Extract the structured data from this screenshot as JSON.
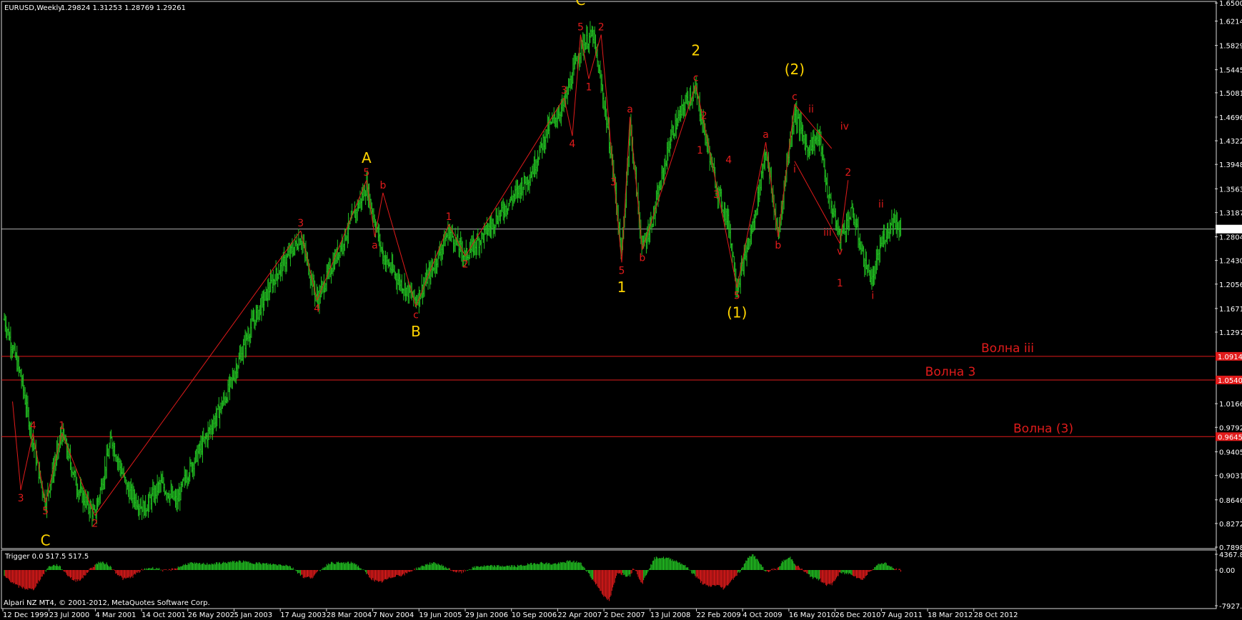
{
  "header": {
    "symbol": "EURUSD,Weekly",
    "ohlc": "1.29824 1.31253 1.28769 1.29261"
  },
  "indicator": {
    "label": "Trigger 0.0 517.5 517.5",
    "ticks": [
      "4367.8",
      "0.00",
      "-7927.2"
    ]
  },
  "footer": {
    "copyright": "Alpari NZ MT4, © 2001-2012, MetaQuotes Software Corp."
  },
  "colors": {
    "background": "#000000",
    "up_bar": "#22c222",
    "wave_line": "#e11b1b",
    "major_label": "#ffd400",
    "minor_label": "#e11b1b",
    "level_line": "#e11b1b",
    "price_line": "#c8c8c8"
  },
  "chart_data": {
    "type": "ohlc",
    "symbol": "EURUSD",
    "timeframe": "Weekly",
    "ylim": [
      0.7898,
      1.6502
    ],
    "price_ticks": [
      "1.62140",
      "1.58290",
      "1.54450",
      "1.50810",
      "1.46960",
      "1.43220",
      "1.39480",
      "1.35630",
      "1.31870",
      "1.28040",
      "1.24300",
      "1.20560",
      "1.16710",
      "1.12970",
      "1.09142",
      "1.05405",
      "1.01660",
      "0.97920",
      "0.94050",
      "0.90310",
      "0.86460",
      "0.82720",
      "0.78980",
      "1.65000"
    ],
    "x_labels": [
      "12 Dec 1999",
      "23 Jul 2000",
      "4 Mar 2001",
      "14 Oct 2001",
      "26 May 2002",
      "5 Jan 2003",
      "17 Aug 2003",
      "28 Mar 2004",
      "7 Nov 2004",
      "19 Jun 2005",
      "29 Jan 2006",
      "10 Sep 2006",
      "22 Apr 2007",
      "2 Dec 2007",
      "13 Jul 2008",
      "22 Feb 2009",
      "4 Oct 2009",
      "16 May 2010",
      "26 Dec 2010",
      "7 Aug 2011",
      "18 Mar 2012",
      "28 Oct 2012"
    ],
    "current_price": "1.29261",
    "price_path": [
      [
        0,
        1.15
      ],
      [
        0.4,
        1.06
      ],
      [
        0.8,
        0.92
      ],
      [
        1.0,
        0.86
      ],
      [
        1.4,
        0.97
      ],
      [
        1.8,
        0.88
      ],
      [
        2.2,
        0.84
      ],
      [
        2.6,
        0.96
      ],
      [
        3.0,
        0.88
      ],
      [
        3.4,
        0.85
      ],
      [
        3.8,
        0.89
      ],
      [
        4.2,
        0.86
      ],
      [
        4.4,
        0.9
      ],
      [
        4.8,
        0.95
      ],
      [
        5.4,
        1.03
      ],
      [
        6.0,
        1.14
      ],
      [
        6.6,
        1.22
      ],
      [
        7.2,
        1.28
      ],
      [
        7.6,
        1.18
      ],
      [
        8.0,
        1.24
      ],
      [
        8.4,
        1.3
      ],
      [
        8.8,
        1.36
      ],
      [
        9.2,
        1.25
      ],
      [
        9.6,
        1.21
      ],
      [
        10.0,
        1.18
      ],
      [
        10.4,
        1.23
      ],
      [
        10.8,
        1.29
      ],
      [
        11.2,
        1.25
      ],
      [
        11.6,
        1.28
      ],
      [
        12.2,
        1.33
      ],
      [
        12.8,
        1.38
      ],
      [
        13.2,
        1.45
      ],
      [
        13.6,
        1.49
      ],
      [
        14.0,
        1.58
      ],
      [
        14.3,
        1.6
      ],
      [
        14.6,
        1.48
      ],
      [
        14.8,
        1.38
      ],
      [
        15.0,
        1.25
      ],
      [
        15.2,
        1.46
      ],
      [
        15.5,
        1.26
      ],
      [
        15.8,
        1.32
      ],
      [
        16.2,
        1.44
      ],
      [
        16.6,
        1.5
      ],
      [
        16.8,
        1.51
      ],
      [
        17.0,
        1.45
      ],
      [
        17.3,
        1.36
      ],
      [
        17.6,
        1.3
      ],
      [
        17.8,
        1.2
      ],
      [
        18.2,
        1.3
      ],
      [
        18.5,
        1.42
      ],
      [
        18.8,
        1.28
      ],
      [
        19.0,
        1.39
      ],
      [
        19.2,
        1.48
      ],
      [
        19.5,
        1.42
      ],
      [
        19.8,
        1.44
      ],
      [
        20.0,
        1.35
      ],
      [
        20.3,
        1.28
      ],
      [
        20.6,
        1.32
      ],
      [
        20.9,
        1.24
      ],
      [
        21.1,
        1.21
      ],
      [
        21.3,
        1.27
      ],
      [
        21.6,
        1.31
      ],
      [
        21.8,
        1.29
      ]
    ],
    "levels": [
      {
        "label": "Волна iii",
        "price": 1.09142,
        "tag": "1.09142"
      },
      {
        "label": "Волна 3",
        "price": 1.05405,
        "tag": "1.05405"
      },
      {
        "label": "Волна (3)",
        "price": 0.9645,
        "tag": "0.96450"
      }
    ],
    "wave_labels_minor": [
      {
        "t": "3",
        "x": 0.4,
        "p": 0.88,
        "pos": "below"
      },
      {
        "t": "4",
        "x": 0.7,
        "p": 0.97,
        "pos": "above"
      },
      {
        "t": "5",
        "x": 1.0,
        "p": 0.86,
        "pos": "below"
      },
      {
        "t": "1",
        "x": 1.4,
        "p": 0.97,
        "pos": "above"
      },
      {
        "t": "2",
        "x": 2.2,
        "p": 0.84,
        "pos": "below"
      },
      {
        "t": "3",
        "x": 7.2,
        "p": 1.29,
        "pos": "above"
      },
      {
        "t": "4",
        "x": 7.6,
        "p": 1.18,
        "pos": "below"
      },
      {
        "t": "5",
        "x": 8.8,
        "p": 1.37,
        "pos": "above"
      },
      {
        "t": "a",
        "x": 9.0,
        "p": 1.28,
        "pos": "below"
      },
      {
        "t": "b",
        "x": 9.2,
        "p": 1.35,
        "pos": "above"
      },
      {
        "t": "c",
        "x": 10.0,
        "p": 1.17,
        "pos": "below"
      },
      {
        "t": "1",
        "x": 10.8,
        "p": 1.3,
        "pos": "above"
      },
      {
        "t": "2",
        "x": 11.2,
        "p": 1.25,
        "pos": "below"
      },
      {
        "t": "3",
        "x": 13.6,
        "p": 1.5,
        "pos": "above"
      },
      {
        "t": "4",
        "x": 13.8,
        "p": 1.44,
        "pos": "below"
      },
      {
        "t": "5",
        "x": 14.0,
        "p": 1.6,
        "pos": "above"
      },
      {
        "t": "1",
        "x": 14.2,
        "p": 1.53,
        "pos": "below"
      },
      {
        "t": "2",
        "x": 14.5,
        "p": 1.6,
        "pos": "above"
      },
      {
        "t": "3",
        "x": 14.8,
        "p": 1.38,
        "pos": "below"
      },
      {
        "t": "5",
        "x": 15.0,
        "p": 1.24,
        "pos": "below"
      },
      {
        "t": "a",
        "x": 15.2,
        "p": 1.47,
        "pos": "above"
      },
      {
        "t": "b",
        "x": 15.5,
        "p": 1.26,
        "pos": "below"
      },
      {
        "t": "c",
        "x": 16.8,
        "p": 1.52,
        "pos": "above"
      },
      {
        "t": "1",
        "x": 16.9,
        "p": 1.43,
        "pos": "below"
      },
      {
        "t": "2",
        "x": 17.0,
        "p": 1.46,
        "pos": "above"
      },
      {
        "t": "3",
        "x": 17.3,
        "p": 1.36,
        "pos": "below"
      },
      {
        "t": "4",
        "x": 17.6,
        "p": 1.39,
        "pos": "above"
      },
      {
        "t": "5",
        "x": 17.8,
        "p": 1.2,
        "pos": "below"
      },
      {
        "t": "a",
        "x": 18.5,
        "p": 1.43,
        "pos": "above"
      },
      {
        "t": "b",
        "x": 18.8,
        "p": 1.28,
        "pos": "below"
      },
      {
        "t": "c",
        "x": 19.2,
        "p": 1.49,
        "pos": "above"
      },
      {
        "t": "i",
        "x": 19.2,
        "p": 1.4,
        "pos": "below"
      },
      {
        "t": "ii",
        "x": 19.6,
        "p": 1.47,
        "pos": "above"
      },
      {
        "t": "iii",
        "x": 20.0,
        "p": 1.3,
        "pos": "below"
      },
      {
        "t": "iv",
        "x": 20.1,
        "p": 1.45,
        "pos": "right"
      },
      {
        "t": "v",
        "x": 20.3,
        "p": 1.27,
        "pos": "below"
      },
      {
        "t": "1",
        "x": 20.3,
        "p": 1.22,
        "pos": "below"
      },
      {
        "t": "2",
        "x": 20.5,
        "p": 1.37,
        "pos": "above"
      },
      {
        "t": "i",
        "x": 21.1,
        "p": 1.2,
        "pos": "below"
      },
      {
        "t": "ii",
        "x": 21.3,
        "p": 1.32,
        "pos": "above"
      }
    ],
    "wave_labels_major": [
      {
        "t": "C",
        "x": 1.0,
        "p": 0.82,
        "pos": "below"
      },
      {
        "t": "A",
        "x": 8.8,
        "p": 1.37,
        "pos": "above2"
      },
      {
        "t": "B",
        "x": 10.0,
        "p": 1.15,
        "pos": "below"
      },
      {
        "t": "C",
        "x": 14.0,
        "p": 1.62,
        "pos": "above2"
      },
      {
        "t": "1",
        "x": 15.0,
        "p": 1.22,
        "pos": "below"
      },
      {
        "t": "2",
        "x": 16.8,
        "p": 1.54,
        "pos": "above2"
      },
      {
        "t": "(1)",
        "x": 17.8,
        "p": 1.18,
        "pos": "below"
      },
      {
        "t": "(2)",
        "x": 19.2,
        "p": 1.51,
        "pos": "above2"
      }
    ],
    "wave_lines": [
      [
        [
          0.2,
          1.02
        ],
        [
          0.4,
          0.88
        ]
      ],
      [
        [
          0.4,
          0.88
        ],
        [
          0.7,
          0.97
        ]
      ],
      [
        [
          0.7,
          0.97
        ],
        [
          1.0,
          0.86
        ]
      ],
      [
        [
          1.0,
          0.86
        ],
        [
          1.4,
          0.97
        ]
      ],
      [
        [
          1.4,
          0.97
        ],
        [
          2.2,
          0.84
        ]
      ],
      [
        [
          2.2,
          0.84
        ],
        [
          7.2,
          1.29
        ]
      ],
      [
        [
          7.2,
          1.29
        ],
        [
          7.6,
          1.18
        ]
      ],
      [
        [
          7.6,
          1.18
        ],
        [
          8.8,
          1.37
        ]
      ],
      [
        [
          8.8,
          1.37
        ],
        [
          9.0,
          1.28
        ]
      ],
      [
        [
          9.0,
          1.28
        ],
        [
          9.2,
          1.35
        ]
      ],
      [
        [
          9.2,
          1.35
        ],
        [
          10.0,
          1.17
        ]
      ],
      [
        [
          10.0,
          1.17
        ],
        [
          10.8,
          1.3
        ]
      ],
      [
        [
          10.8,
          1.3
        ],
        [
          11.2,
          1.25
        ]
      ],
      [
        [
          11.2,
          1.25
        ],
        [
          13.6,
          1.5
        ]
      ],
      [
        [
          13.6,
          1.5
        ],
        [
          13.8,
          1.44
        ]
      ],
      [
        [
          13.8,
          1.44
        ],
        [
          14.0,
          1.6
        ]
      ],
      [
        [
          14.0,
          1.6
        ],
        [
          14.2,
          1.53
        ]
      ],
      [
        [
          14.2,
          1.53
        ],
        [
          14.5,
          1.6
        ]
      ],
      [
        [
          14.5,
          1.6
        ],
        [
          14.8,
          1.38
        ]
      ],
      [
        [
          14.8,
          1.38
        ],
        [
          15.0,
          1.24
        ]
      ],
      [
        [
          15.0,
          1.24
        ],
        [
          15.2,
          1.47
        ]
      ],
      [
        [
          15.2,
          1.47
        ],
        [
          15.5,
          1.26
        ]
      ],
      [
        [
          15.5,
          1.26
        ],
        [
          16.8,
          1.52
        ]
      ],
      [
        [
          16.8,
          1.52
        ],
        [
          17.0,
          1.46
        ]
      ],
      [
        [
          17.0,
          1.46
        ],
        [
          17.8,
          1.2
        ]
      ],
      [
        [
          17.8,
          1.2
        ],
        [
          18.5,
          1.43
        ]
      ],
      [
        [
          18.5,
          1.43
        ],
        [
          18.8,
          1.28
        ]
      ],
      [
        [
          18.8,
          1.28
        ],
        [
          19.2,
          1.49
        ]
      ],
      [
        [
          19.2,
          1.49
        ],
        [
          20.1,
          1.42
        ]
      ],
      [
        [
          19.2,
          1.4
        ],
        [
          20.3,
          1.27
        ]
      ],
      [
        [
          20.3,
          1.27
        ],
        [
          20.5,
          1.37
        ]
      ]
    ]
  }
}
